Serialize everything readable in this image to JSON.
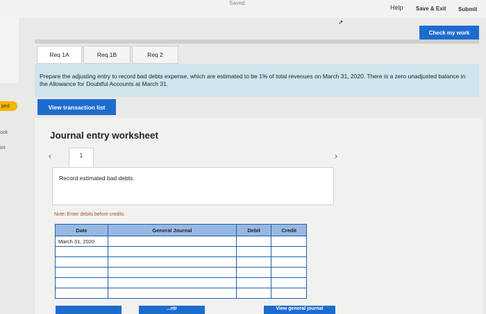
{
  "topbar": {
    "saved": "Saved",
    "help": "Help",
    "save_exit": "Save & Exit",
    "submit": "Submit"
  },
  "check_work": "Check my work",
  "tabs": [
    {
      "label": "Req 1A",
      "active": true
    },
    {
      "label": "Req 1B",
      "active": false
    },
    {
      "label": "Req 2",
      "active": false
    }
  ],
  "instructions": "Prepare the adjusting entry to record bad debts expense, which are estimated to be 1% of total revenues on March 31, 2020. There is a zero unadjusted balance in the Allowance for Doubtful Accounts at March 31.",
  "side_labels": {
    "ped": "ped",
    "ok": "ook",
    "int": "int"
  },
  "view_transaction_list": "View transaction list",
  "worksheet": {
    "title": "Journal entry worksheet",
    "page": "1",
    "prev_icon": "‹",
    "next_icon": "›",
    "description": "Record estimated bad debts.",
    "note": "Note: Enter debits before credits.",
    "headers": [
      "Date",
      "General Journal",
      "Debit",
      "Credit"
    ],
    "rows": [
      [
        "March 31, 2020",
        "",
        "",
        ""
      ],
      [
        "",
        "",
        "",
        ""
      ],
      [
        "",
        "",
        "",
        ""
      ],
      [
        "",
        "",
        "",
        ""
      ],
      [
        "",
        "",
        "",
        ""
      ],
      [
        "",
        "",
        "",
        ""
      ]
    ]
  },
  "bottom_buttons": {
    "left": "",
    "middle": "...ntr",
    "right": "View general journal"
  },
  "colors": {
    "primary": "#1e6bd0",
    "header_blue": "#97b8e3",
    "instruction_bg": "#cfe4ec",
    "badge_yellow": "#f4b400"
  }
}
